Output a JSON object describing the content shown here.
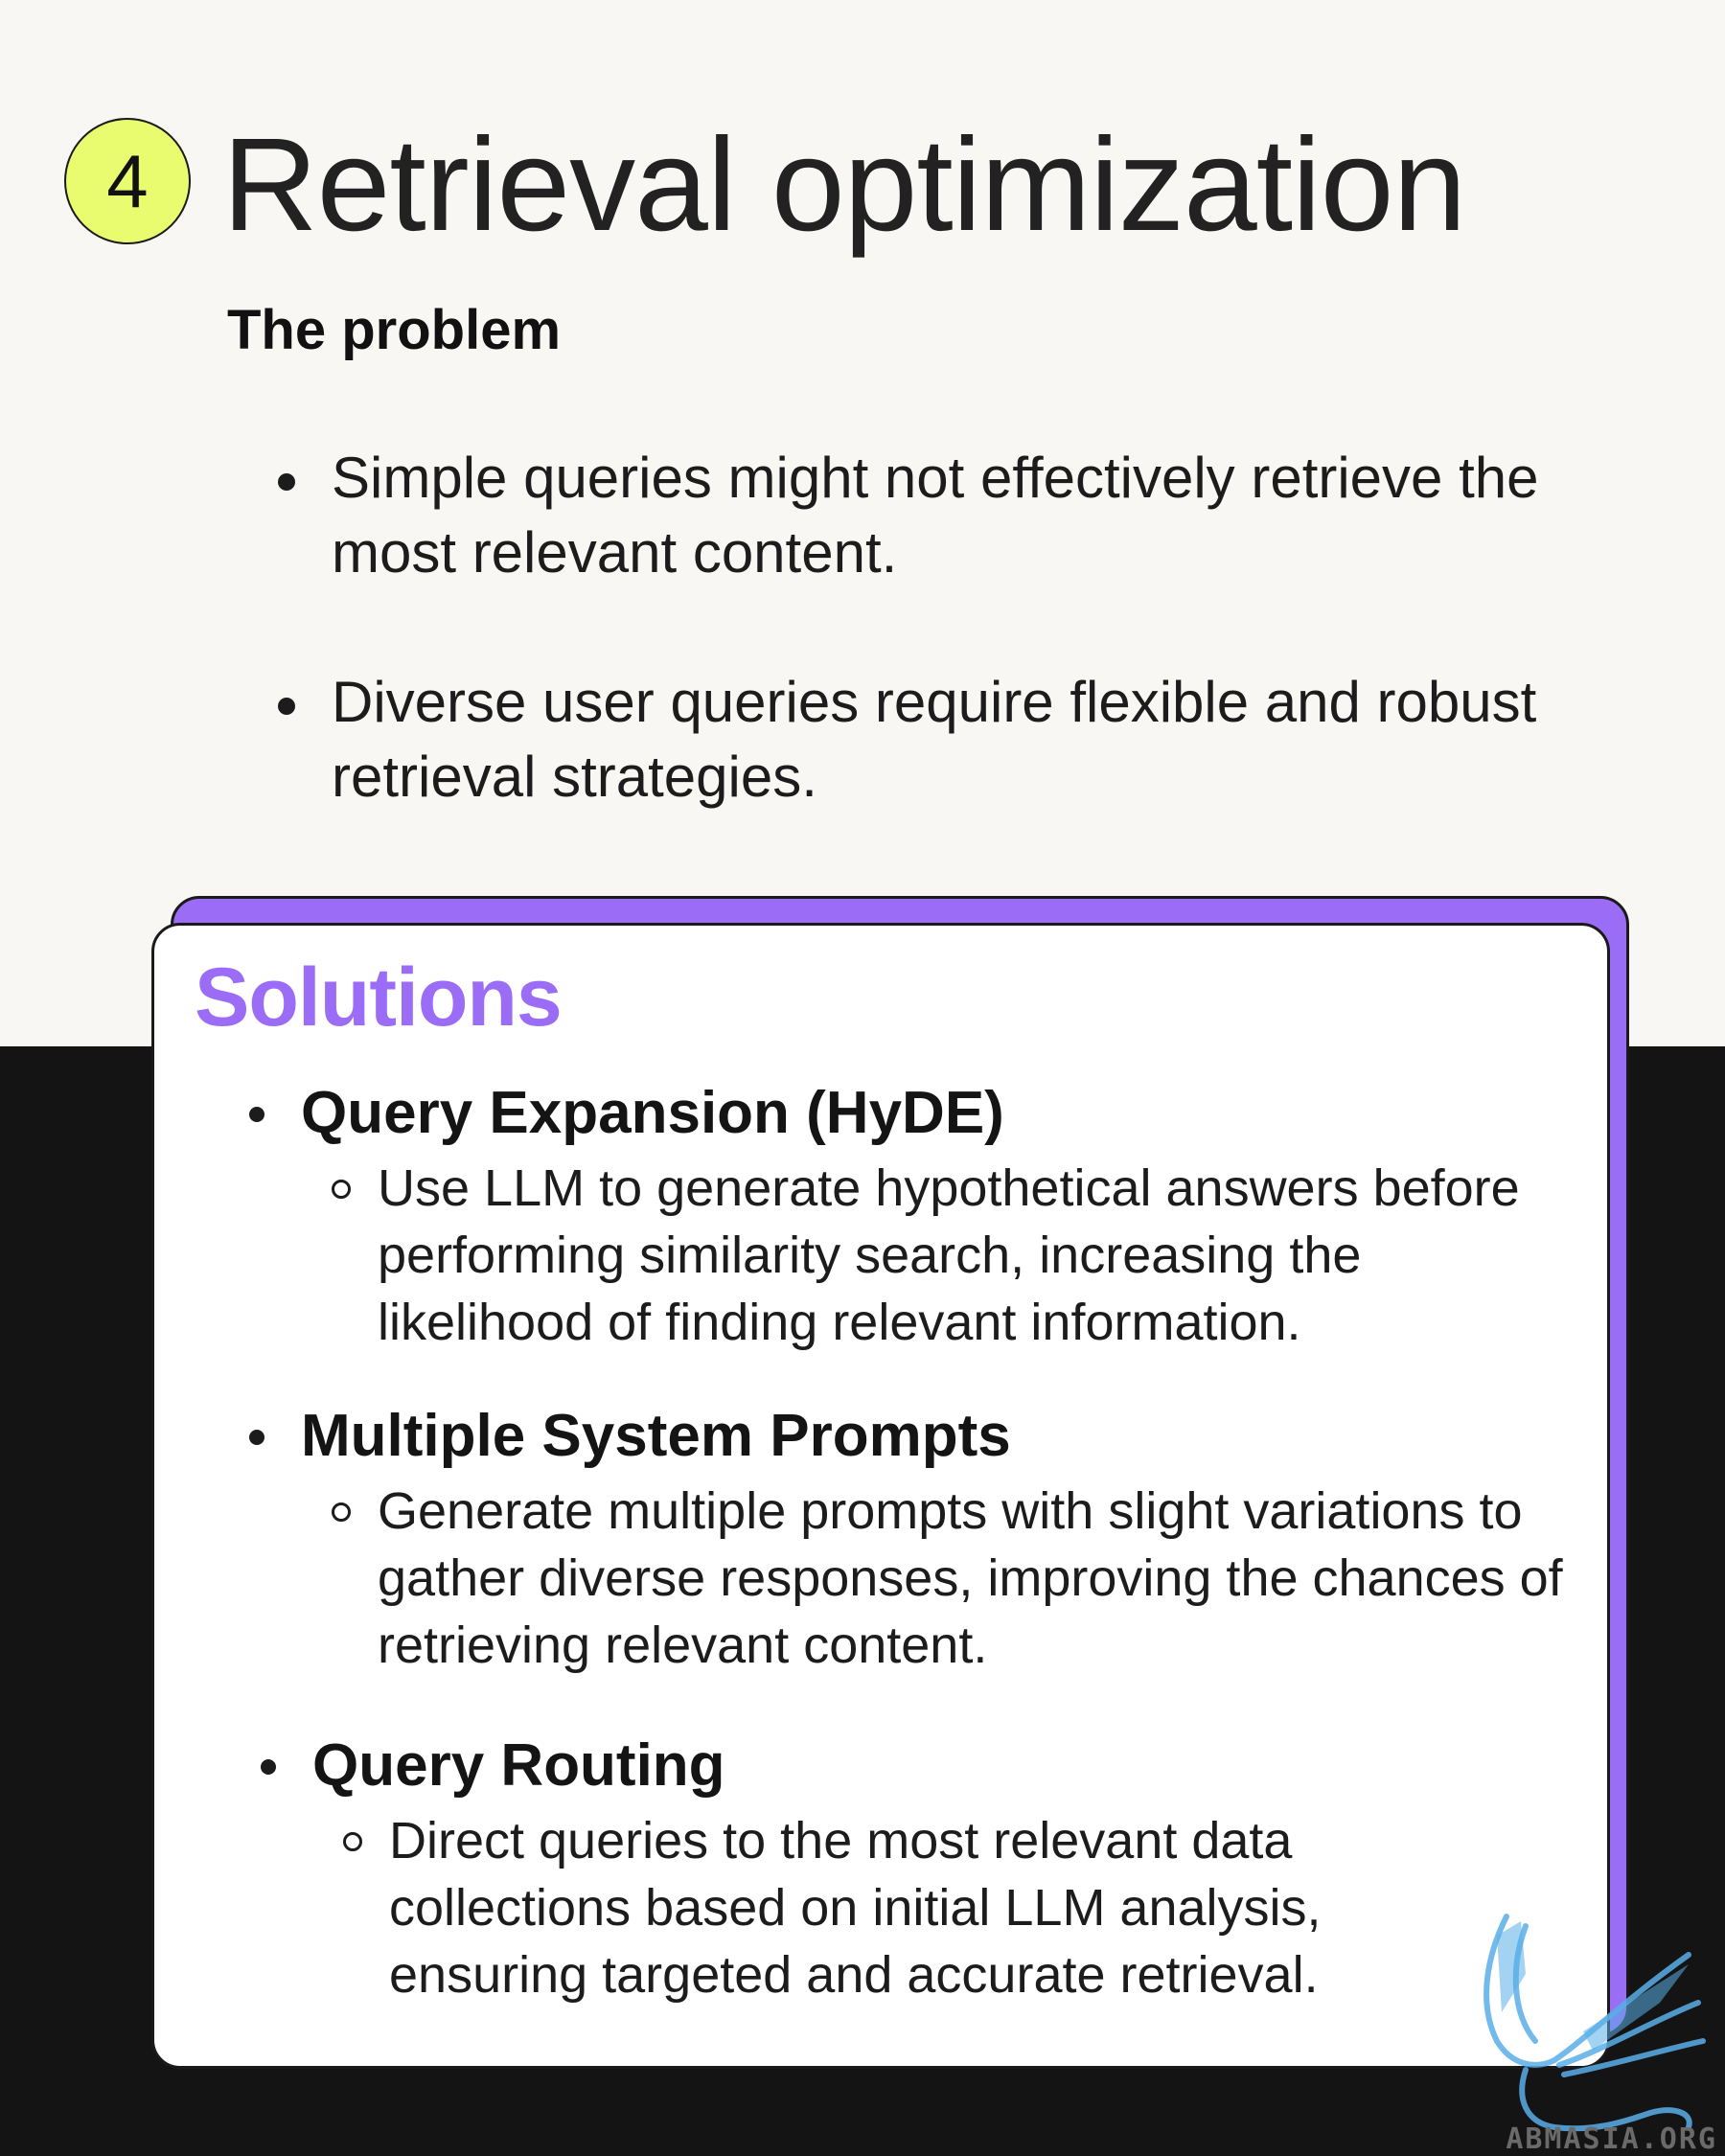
{
  "header": {
    "step_number": "4",
    "title": "Retrieval optimization"
  },
  "problem": {
    "heading": "The problem",
    "bullets": [
      "Simple queries might not effectively retrieve the most relevant content.",
      "Diverse user queries require flexible and robust retrieval strategies."
    ]
  },
  "solutions": {
    "heading": "Solutions",
    "items": [
      {
        "title": "Query Expansion (HyDE)",
        "description": "Use LLM to generate hypothetical answers before performing similarity search, increasing the likelihood of finding relevant information."
      },
      {
        "title": "Multiple System Prompts",
        "description": "Generate multiple prompts with slight variations to gather diverse responses, improving the chances of retrieving relevant content."
      },
      {
        "title": "Query Routing",
        "description": "Direct queries to the most relevant data collections based on initial LLM analysis, ensuring targeted and accurate retrieval."
      }
    ]
  },
  "watermark": {
    "text": "ABMASIA.ORG"
  },
  "colors": {
    "background_top": "#f8f7f4",
    "background_bottom": "#141414",
    "badge": "#e9fb6f",
    "accent_purple": "#9b6cf5",
    "watermark_blue": "#5aaee8"
  }
}
